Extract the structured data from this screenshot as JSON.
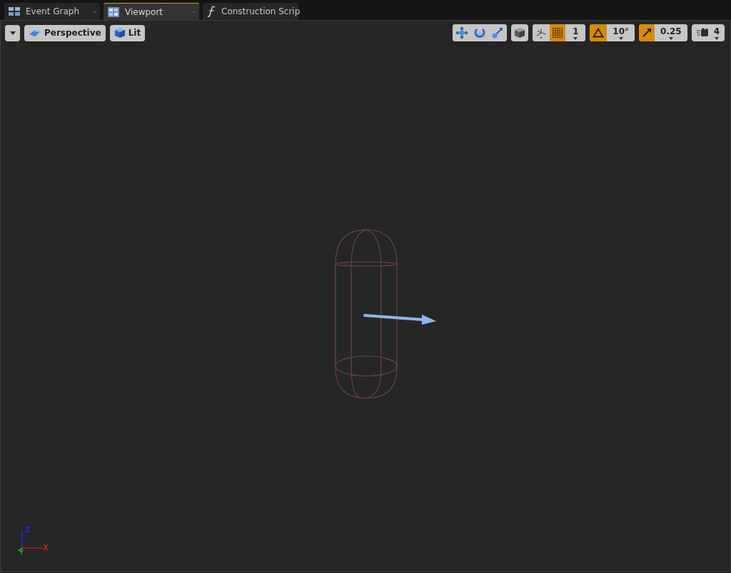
{
  "tabs": [
    {
      "label": "Event Graph",
      "selected": false
    },
    {
      "label": "Viewport",
      "selected": true
    },
    {
      "label": "Construction Scrip",
      "selected": false
    }
  ],
  "toolbar_left": [
    {
      "kind": "menu"
    },
    {
      "kind": "button",
      "label": "Perspective"
    },
    {
      "kind": "button",
      "label": "Lit"
    }
  ],
  "toolbar_right": [
    {
      "items": [
        {
          "kind": "icon"
        },
        {
          "kind": "icon"
        },
        {
          "kind": "icon"
        }
      ]
    },
    {
      "items": [
        {
          "kind": "icon"
        }
      ]
    },
    {
      "items": [
        {
          "kind": "icon"
        },
        {
          "kind": "toggle",
          "on": true
        },
        {
          "kind": "value",
          "label": "1"
        }
      ]
    },
    {
      "items": [
        {
          "kind": "toggle",
          "on": true
        },
        {
          "kind": "value",
          "label": "10°"
        }
      ]
    },
    {
      "items": [
        {
          "kind": "toggle",
          "on": true
        },
        {
          "kind": "value",
          "label": "0.25"
        }
      ]
    },
    {
      "items": [
        {
          "kind": "speed",
          "label": "4"
        }
      ]
    }
  ],
  "axis_gizmo": {
    "z": "Z",
    "y": "Y",
    "x": "X"
  }
}
